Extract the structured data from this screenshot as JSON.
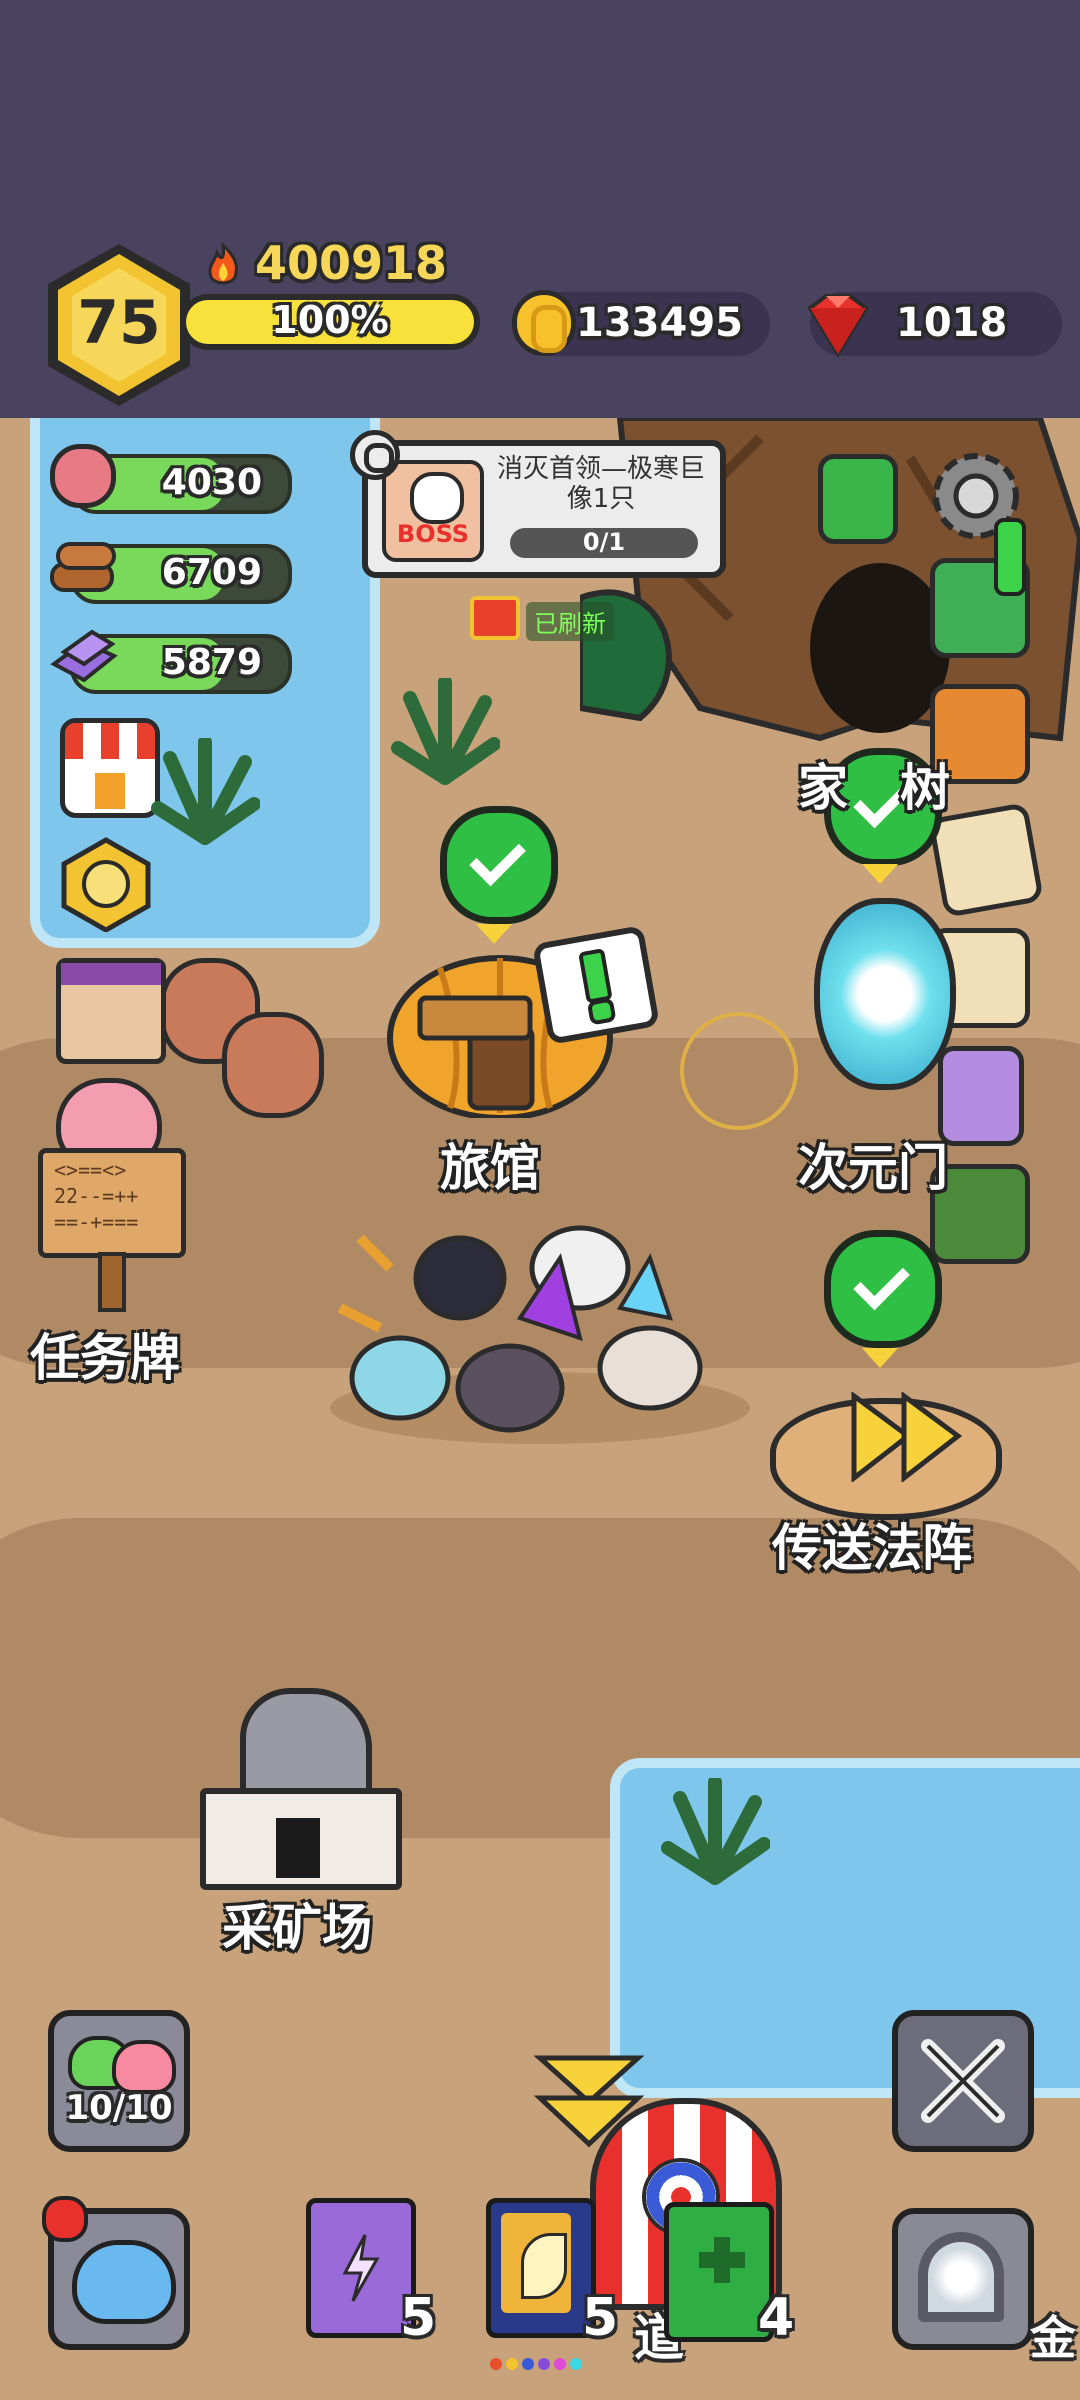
{
  "header": {
    "level": "75",
    "power": "400918",
    "exp_percent_label": "100%",
    "exp_fraction": 1.0,
    "gold": "133495",
    "gems": "1018"
  },
  "resources": [
    {
      "name": "meat-icon",
      "value": "4030"
    },
    {
      "name": "wood-icon",
      "value": "6709"
    },
    {
      "name": "crystal-icon",
      "value": "5879"
    }
  ],
  "quest": {
    "boss_badge": "BOSS",
    "text": "消灭首领—极寒巨像1只",
    "progress": "0/1",
    "refreshed": "已刷新"
  },
  "locations": {
    "inn": "旅馆",
    "portal": "次元门",
    "task_board": "任务牌",
    "teleport": "传送法阵",
    "mine": "采矿场",
    "home_partial": "家",
    "home_partial_end": "树"
  },
  "sign_text": [
    "<>==<>",
    "22--=++",
    "==-+==="
  ],
  "bottom": {
    "slime_count": "10/10",
    "book_purple_count": "5",
    "book_yellow_count": "5",
    "book_green_count": "4",
    "center_partial": "道",
    "right_partial": "金"
  },
  "colors": {
    "header_bg": "#4a4360",
    "level_hex": "#f3c431",
    "exp_bar": "#f7e13a",
    "res_fill": "#79d95a",
    "check_green": "#2fbf44"
  }
}
